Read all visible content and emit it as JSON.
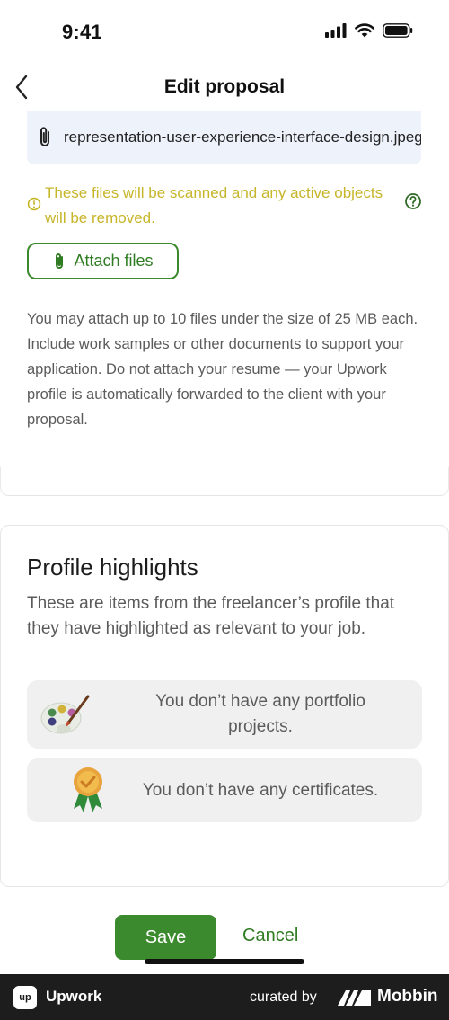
{
  "status_bar": {
    "time": "9:41"
  },
  "nav": {
    "title": "Edit proposal",
    "back_icon": "chevron-left-icon"
  },
  "attachment": {
    "file_name": "representation-user-experience-interface-design.jpeg",
    "file_icon": "paperclip-icon"
  },
  "warning": {
    "text": "These files will be scanned and any active objects will be removed.",
    "color": "#c7b52a"
  },
  "attach_button": {
    "label": "Attach files",
    "icon": "paperclip-icon"
  },
  "attach_description": "You may attach up to 10 files under the size of 25 MB each. Include work samples or other documents to support your application. Do not attach your resume — your Upwork profile is automatically forwarded to the client with your proposal.",
  "profile_highlights": {
    "title": "Profile highlights",
    "description": "These are items from the freelancer’s profile that they have highlighted as relevant to your job.",
    "portfolio_empty": "You don’t have any portfolio projects.",
    "certificates_empty": "You don’t have any certificates."
  },
  "actions": {
    "save_label": "Save",
    "cancel_label": "Cancel"
  },
  "footer": {
    "brand": "Upwork",
    "logo_text": "up",
    "curated_by": "curated by",
    "mobbin": "Mobbin"
  },
  "colors": {
    "accent": "#3c8a2e",
    "accent_text": "#2f7c22",
    "chip_bg": "#eef2fb"
  }
}
